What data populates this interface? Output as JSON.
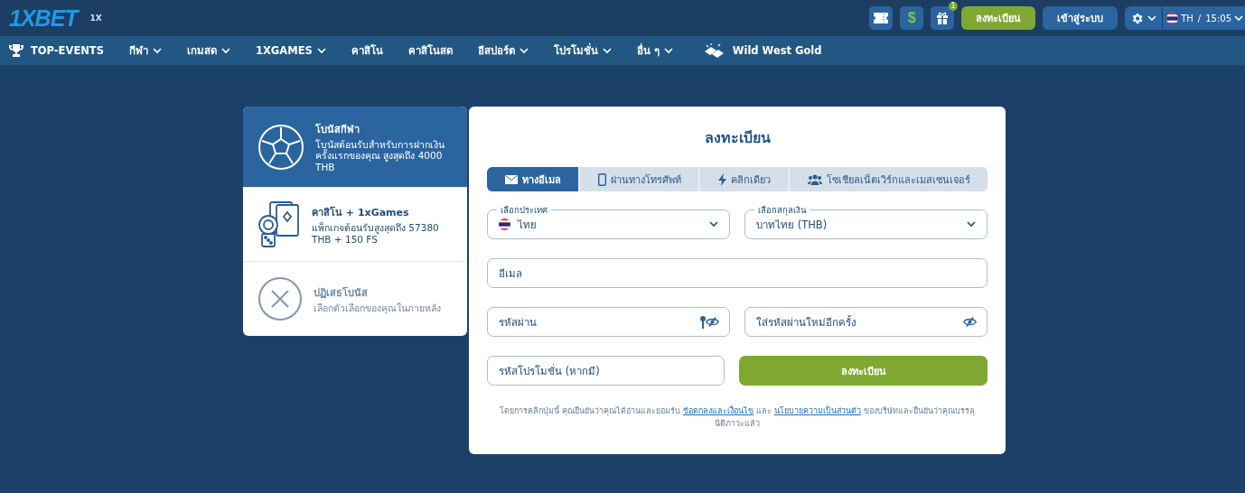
{
  "header": {
    "logo": "1XBET",
    "logo_badge": "1X",
    "icon_buttons": [
      {
        "kind": "ticket"
      },
      {
        "kind": "dollar",
        "text": "$"
      },
      {
        "kind": "gift",
        "badge": "1"
      }
    ],
    "register": "ลงทะเบียน",
    "login": "เข้าสู่ระบบ",
    "language": "TH",
    "separator": "/",
    "time": "15:05"
  },
  "nav": [
    {
      "label": "TOP-EVENTS",
      "kind": "trophy",
      "caret": false
    },
    {
      "label": "กีฬา",
      "caret": true
    },
    {
      "label": "เกมสด",
      "caret": true
    },
    {
      "label": "1XGAMES",
      "caret": true
    },
    {
      "label": "คาสิโน",
      "caret": false
    },
    {
      "label": "คาสิโนสด",
      "caret": false
    },
    {
      "label": "อีสปอร์ต",
      "caret": true
    },
    {
      "label": "โปรโมชั่น",
      "caret": true
    },
    {
      "label": "อื่น ๆ",
      "caret": true
    },
    {
      "label": "Wild West Gold",
      "kind": "gold",
      "caret": false
    }
  ],
  "bonuses": [
    {
      "kind": "ball",
      "title": "โบนัสกีฬา",
      "description": "โบนัสต้อนรับสำหรับการฝากเงินครั้งแรกของคุณ สูงสุดถึง 4000 THB",
      "selected": true
    },
    {
      "kind": "casino",
      "title": "คาสิโน + 1xGames",
      "description": "แพ็กเกจต้อนรับสูงสุดถึง 57380 THB + 150 FS",
      "selected": false
    },
    {
      "kind": "decline",
      "title": "ปฏิเสธโบนัส",
      "description": "เลือกตัวเลือกของคุณในภายหลัง",
      "selected": false
    }
  ],
  "form": {
    "title": "ลงทะเบียน",
    "tabs": [
      {
        "kind": "email",
        "label": "ทางอีเมล",
        "selected": true
      },
      {
        "kind": "phone",
        "label": "ผ่านทางโทรศัพท์",
        "selected": false
      },
      {
        "kind": "bolt",
        "label": "คลิกเดียว",
        "selected": false
      },
      {
        "kind": "social",
        "label": "โซเชียลเน็ตเวิร์กและเมสเซนเจอร์",
        "selected": false
      }
    ],
    "country": {
      "label": "เลือกประเทศ",
      "value": "ไทย"
    },
    "currency": {
      "label": "เลือกสกุลเงิน",
      "value": "บาทไทย (THB)"
    },
    "email": {
      "placeholder": "อีเมล"
    },
    "password": {
      "placeholder": "รหัสผ่าน"
    },
    "confirm_password": {
      "placeholder": "ใส่รหัสผ่านใหม่อีกครั้ง"
    },
    "promo_code": {
      "placeholder": "รหัสโปรโมชั่น (หากมี)"
    },
    "submit": "ลงทะเบียน",
    "legal": [
      {
        "text": "โดยการคลิกปุ่มนี้ คุณยืนยันว่าคุณได้อ่านและยอมรับ ",
        "link": false
      },
      {
        "text": "ข้อตกลงและเงื่อนไข",
        "link": true
      },
      {
        "text": " และ ",
        "link": false
      },
      {
        "text": "นโยบายความเป็นส่วนตัว",
        "link": true
      },
      {
        "text": " ของบริษัทและยืนยันว่าคุณบรรลุนิติภาวะแล้ว",
        "link": false
      }
    ]
  }
}
